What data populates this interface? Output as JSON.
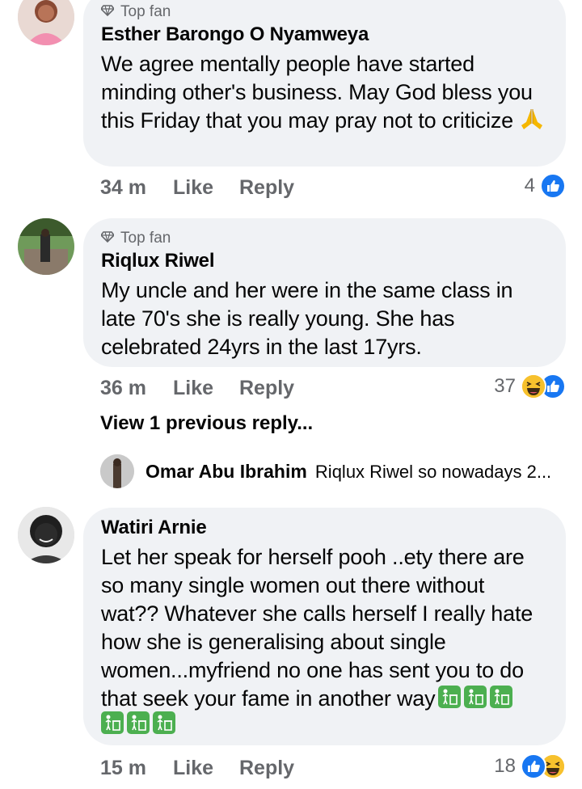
{
  "comments": [
    {
      "badge": "Top fan",
      "author": "Esther Barongo O Nyamweya",
      "text": "We agree mentally people have started minding other's business. May God bless you this Friday that you may pray not to criticize",
      "time": "34 m",
      "like_label": "Like",
      "reply_label": "Reply",
      "reaction_count": "4"
    },
    {
      "badge": "Top fan",
      "author": "Riqlux Riwel",
      "text": "My uncle and her were in the same class in late 70's she is really young. She has celebrated 24yrs in the last 17yrs.",
      "time": "36 m",
      "like_label": "Like",
      "reply_label": "Reply",
      "reaction_count": "37"
    },
    {
      "author": "Watiri Arnie",
      "text": "Let her speak for herself  pooh ..ety there are so many single women out there without wat?? Whatever she calls herself I really hate how she is generalising about single women...myfriend no one has sent you to do that seek your fame in another way",
      "time": "15 m",
      "like_label": "Like",
      "reply_label": "Reply",
      "reaction_count": "18"
    }
  ],
  "view_replies": "View 1 previous reply...",
  "reply_preview": {
    "author": "Omar Abu Ibrahim",
    "text": "Riqlux Riwel so nowadays 2..."
  },
  "colors": {
    "bubble": "#f0f2f5",
    "muted": "#65676b",
    "like_blue": "#1877f2",
    "haha_yellow": "#f7c12d",
    "emoji_green": "#4caf50"
  },
  "icons": [
    "diamond-icon",
    "folded-hands-icon",
    "like-reaction-icon",
    "haha-reaction-icon",
    "litter-bin-emoji-icon"
  ]
}
